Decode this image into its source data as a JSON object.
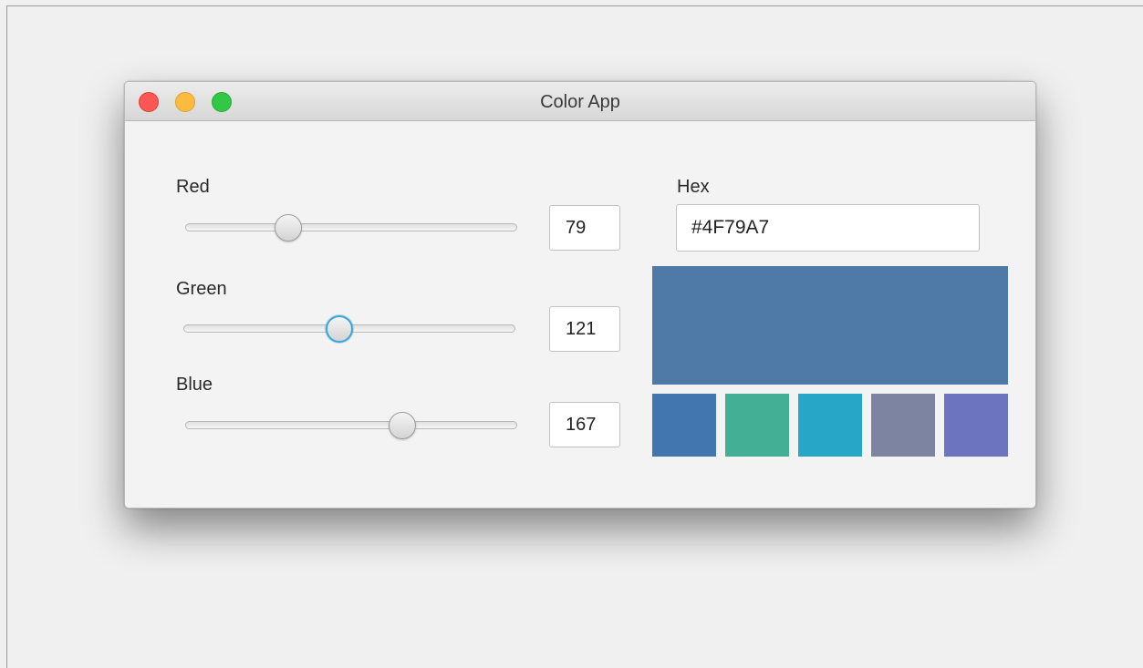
{
  "window": {
    "title": "Color App"
  },
  "controls": {
    "red": {
      "label": "Red",
      "value": "79",
      "fraction": 0.31
    },
    "green": {
      "label": "Green",
      "value": "121",
      "fraction": 0.47
    },
    "blue": {
      "label": "Blue",
      "value": "167",
      "fraction": 0.655
    }
  },
  "hex": {
    "label": "Hex",
    "value": "#4F79A7"
  },
  "preview": {
    "color": "#4F79A7"
  },
  "swatches": [
    {
      "color": "#4276AF"
    },
    {
      "color": "#43B096"
    },
    {
      "color": "#27A6C8"
    },
    {
      "color": "#7D84A1"
    },
    {
      "color": "#6C73BF"
    }
  ],
  "colors": {
    "slider_focus": "#3BA6D5",
    "traffic_close": "#FC5753",
    "traffic_minimize": "#FDBC40",
    "traffic_zoom": "#33C748"
  }
}
